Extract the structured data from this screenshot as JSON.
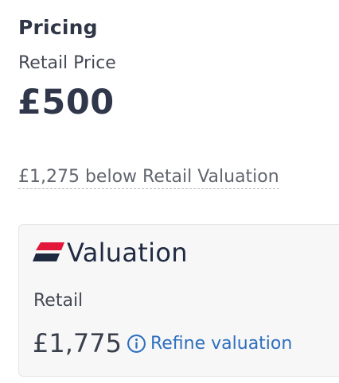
{
  "pricing": {
    "title": "Pricing",
    "retail_price_label": "Retail Price",
    "retail_price_value": "£500",
    "below_valuation_text": "£1,275 below Retail Valuation"
  },
  "valuation_card": {
    "brand_name": "Valuation",
    "retail_label": "Retail",
    "retail_amount": "£1,775",
    "refine_link_label": "Refine valuation"
  },
  "colors": {
    "logo_red": "#e3173a",
    "logo_navy": "#1f2940",
    "link_blue": "#2f6fbd"
  },
  "icons": {
    "logo": "valuation-logo-stripes",
    "info": "info-circle-icon"
  }
}
